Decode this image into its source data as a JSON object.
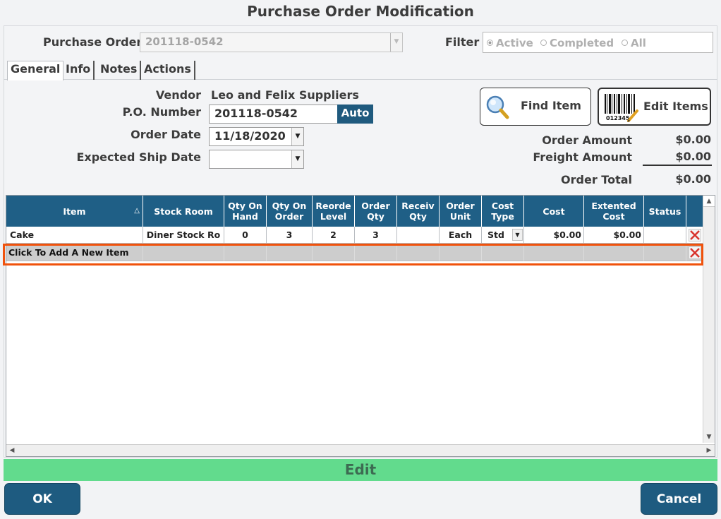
{
  "window": {
    "title": "Purchase Order Modification"
  },
  "header": {
    "po_label": "Purchase Order",
    "po_value": "201118-0542",
    "filter_label": "Filter",
    "filter_options": [
      {
        "label": "Active",
        "selected": true
      },
      {
        "label": "Completed",
        "selected": false
      },
      {
        "label": "All",
        "selected": false
      }
    ]
  },
  "tabs": [
    {
      "label": "General",
      "active": true
    },
    {
      "label": "Info",
      "active": false
    },
    {
      "label": "Notes",
      "active": false
    },
    {
      "label": "Actions",
      "active": false
    }
  ],
  "form": {
    "vendor_label": "Vendor",
    "vendor_value": "Leo and Felix Suppliers",
    "po_number_label": "P.O. Number",
    "po_number_value": "201118-0542",
    "auto_label": "Auto",
    "order_date_label": "Order Date",
    "order_date_value": "11/18/2020",
    "expected_ship_label": "Expected Ship Date",
    "expected_ship_value": ""
  },
  "actions": {
    "find_item": "Find Item",
    "edit_items": "Edit Items",
    "barcode_digits": "012345"
  },
  "totals": {
    "order_amount_label": "Order Amount",
    "order_amount": "$0.00",
    "freight_amount_label": "Freight Amount",
    "freight_amount": "$0.00",
    "order_total_label": "Order Total",
    "order_total": "$0.00"
  },
  "grid": {
    "columns": [
      {
        "line1": "Item",
        "line2": ""
      },
      {
        "line1": "Stock Room",
        "line2": ""
      },
      {
        "line1": "Qty On",
        "line2": "Hand"
      },
      {
        "line1": "Qty On",
        "line2": "Order"
      },
      {
        "line1": "Reorde",
        "line2": "Level"
      },
      {
        "line1": "Order",
        "line2": "Qty"
      },
      {
        "line1": "Receiv",
        "line2": "Qty"
      },
      {
        "line1": "Order",
        "line2": "Unit"
      },
      {
        "line1": "Cost",
        "line2": "Type"
      },
      {
        "line1": "Cost",
        "line2": ""
      },
      {
        "line1": "Extented",
        "line2": "Cost"
      },
      {
        "line1": "Status",
        "line2": ""
      }
    ],
    "rows": [
      {
        "item": "Cake",
        "stock_room": "Diner Stock Ro",
        "qty_on_hand": "0",
        "qty_on_order": "3",
        "reorder_level": "2",
        "order_qty": "3",
        "receiv_qty": "",
        "order_unit": "Each",
        "cost_type": "Std",
        "cost": "$0.00",
        "extended_cost": "$0.00",
        "status": ""
      }
    ],
    "new_item_label": "Click To Add A New Item"
  },
  "footer": {
    "mode_label": "Edit",
    "ok_label": "OK",
    "cancel_label": "Cancel"
  },
  "colors": {
    "primary": "#1f5f86",
    "edit_bar": "#62db8d",
    "highlight": "#f0520c",
    "delete_x": "#d8332c"
  }
}
